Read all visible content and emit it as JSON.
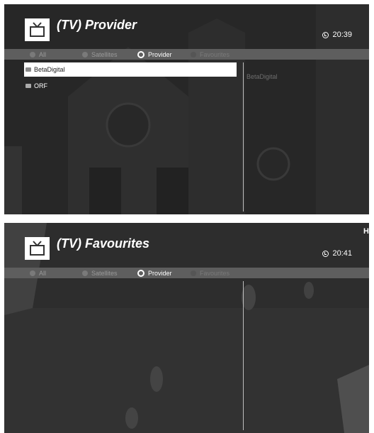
{
  "screens": [
    {
      "title": "(TV) Provider",
      "time": "20:39",
      "tabs": [
        {
          "label": "All",
          "state": "inactive"
        },
        {
          "label": "Satellites",
          "state": "inactive"
        },
        {
          "label": "Provider",
          "state": "active"
        },
        {
          "label": "Favourites",
          "state": "dim"
        }
      ],
      "items": [
        {
          "label": "BetaDigital",
          "selected": true
        },
        {
          "label": "ORF",
          "selected": false
        }
      ],
      "preview": "BetaDigital"
    },
    {
      "title": "(TV) Favourites",
      "time": "20:41",
      "tabs": [
        {
          "label": "All",
          "state": "inactive"
        },
        {
          "label": "Satellites",
          "state": "inactive"
        },
        {
          "label": "Provider",
          "state": "active"
        },
        {
          "label": "Favourites",
          "state": "dim"
        }
      ],
      "items": [],
      "preview": "",
      "corner_label": "H"
    }
  ],
  "colors": {
    "menu_bar": "#5e5e5e",
    "selection": "#ffffff",
    "text": "#ffffff"
  }
}
